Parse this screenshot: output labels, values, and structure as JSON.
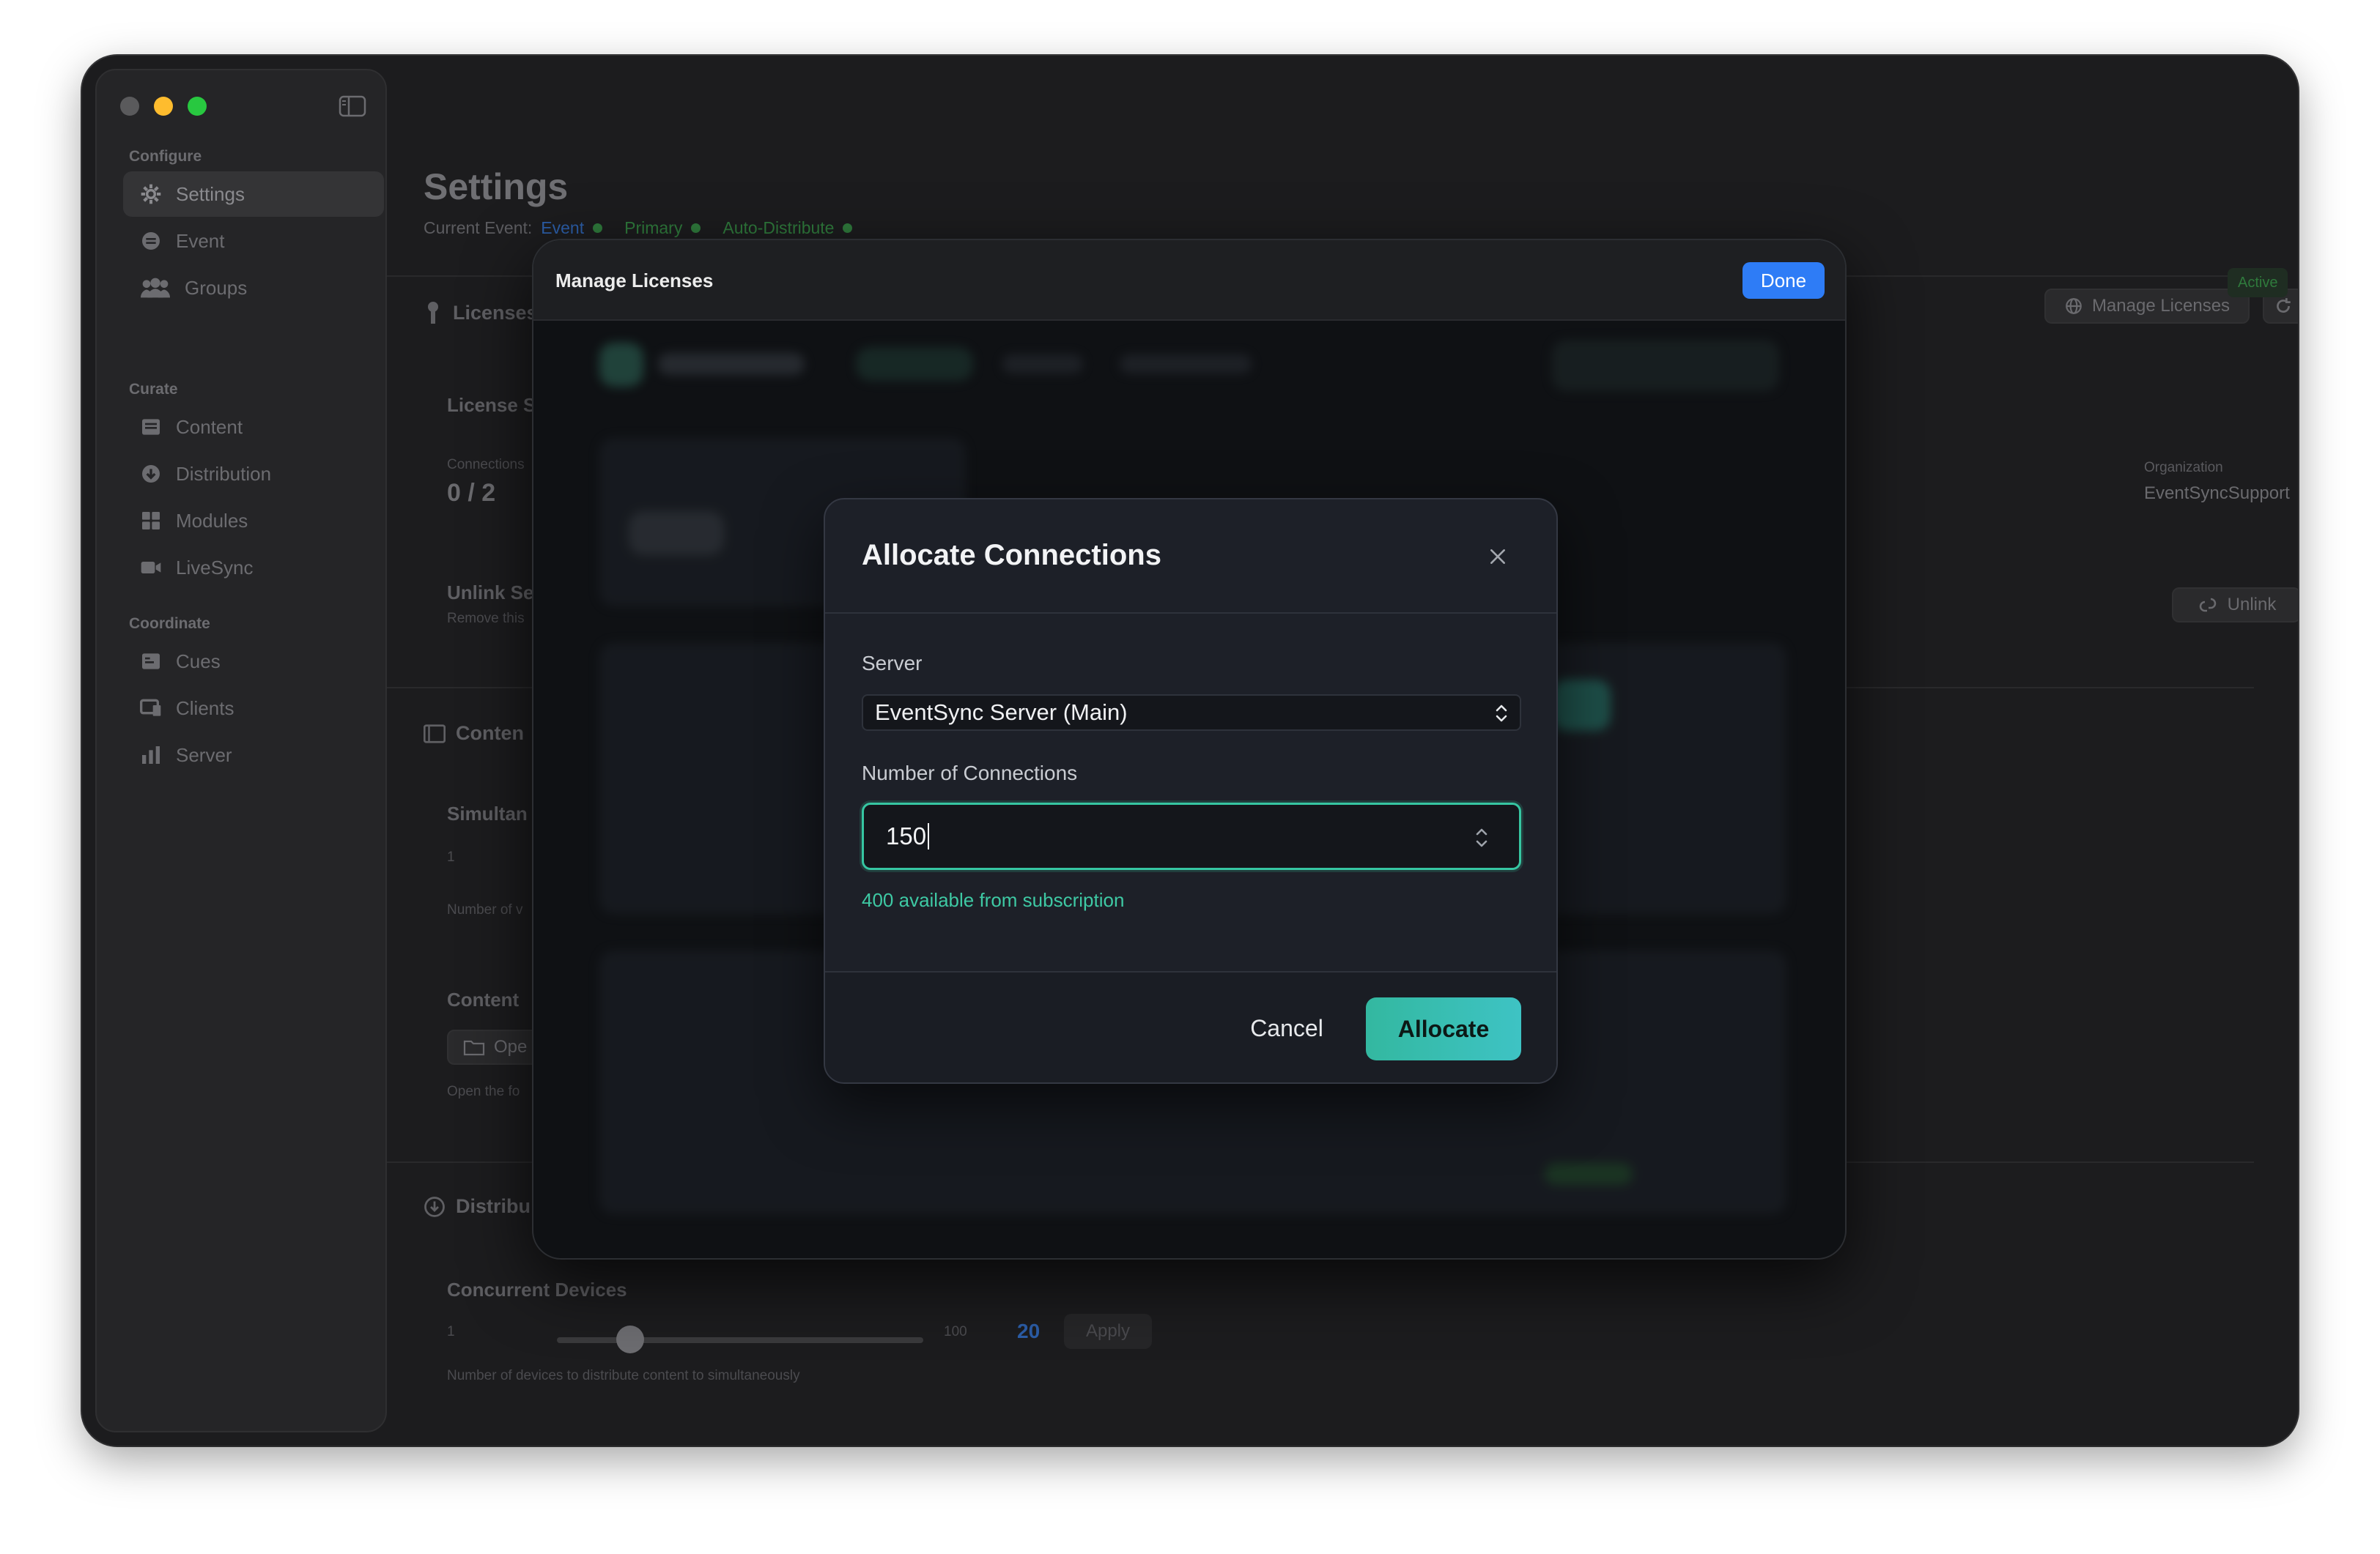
{
  "sidebar": {
    "sections": [
      {
        "label": "Configure",
        "items": [
          {
            "label": "Settings",
            "icon": "gear-icon"
          },
          {
            "label": "Event",
            "icon": "event-icon"
          },
          {
            "label": "Groups",
            "icon": "groups-icon"
          }
        ]
      },
      {
        "label": "Curate",
        "items": [
          {
            "label": "Content",
            "icon": "content-icon"
          },
          {
            "label": "Distribution",
            "icon": "distribution-icon"
          },
          {
            "label": "Modules",
            "icon": "modules-icon"
          },
          {
            "label": "LiveSync",
            "icon": "camera-icon"
          }
        ]
      },
      {
        "label": "Coordinate",
        "items": [
          {
            "label": "Cues",
            "icon": "cues-icon"
          },
          {
            "label": "Clients",
            "icon": "clients-icon"
          },
          {
            "label": "Server",
            "icon": "server-icon"
          }
        ]
      }
    ]
  },
  "main": {
    "title": "Settings",
    "current_event_label": "Current Event:",
    "event_name": "Event",
    "tag_primary": "Primary",
    "tag_auto": "Auto-Distribute",
    "licenses_head": "Licenses",
    "manage_licenses_btn": "Manage Licenses",
    "license_status": "License S",
    "active_badge": "Active",
    "connections_label": "Connections",
    "connections_value": "0 / 2",
    "organization_label": "Organization",
    "organization_value": "EventSyncSupport",
    "unlink_title": "Unlink Se",
    "unlink_desc": "Remove this",
    "unlink_btn": "Unlink",
    "content_head": "Conten",
    "simultaneous_label": "Simultan",
    "simultaneous_min": "1",
    "simultaneous_desc": "Number of v",
    "content_folder_label": "Content",
    "open_btn": "Ope",
    "open_desc": "Open the fo",
    "distribution_head": "Distribu",
    "concurrent_label": "Concurrent Devices",
    "concurrent_min": "1",
    "concurrent_max": "100",
    "concurrent_value": "20",
    "concurrent_level": 0.2,
    "apply_btn": "Apply",
    "concurrent_desc": "Number of devices to distribute content to simultaneously"
  },
  "sheet": {
    "title": "Manage Licenses",
    "done_label": "Done"
  },
  "dialog": {
    "title": "Allocate Connections",
    "server_label": "Server",
    "server_value": "EventSync Server (Main)",
    "connections_label": "Number of Connections",
    "connections_value": "150",
    "hint": "400 available from subscription",
    "cancel_label": "Cancel",
    "allocate_label": "Allocate"
  },
  "colors": {
    "accent_teal": "#3ec9a4",
    "done_blue": "#2e7cf6"
  }
}
